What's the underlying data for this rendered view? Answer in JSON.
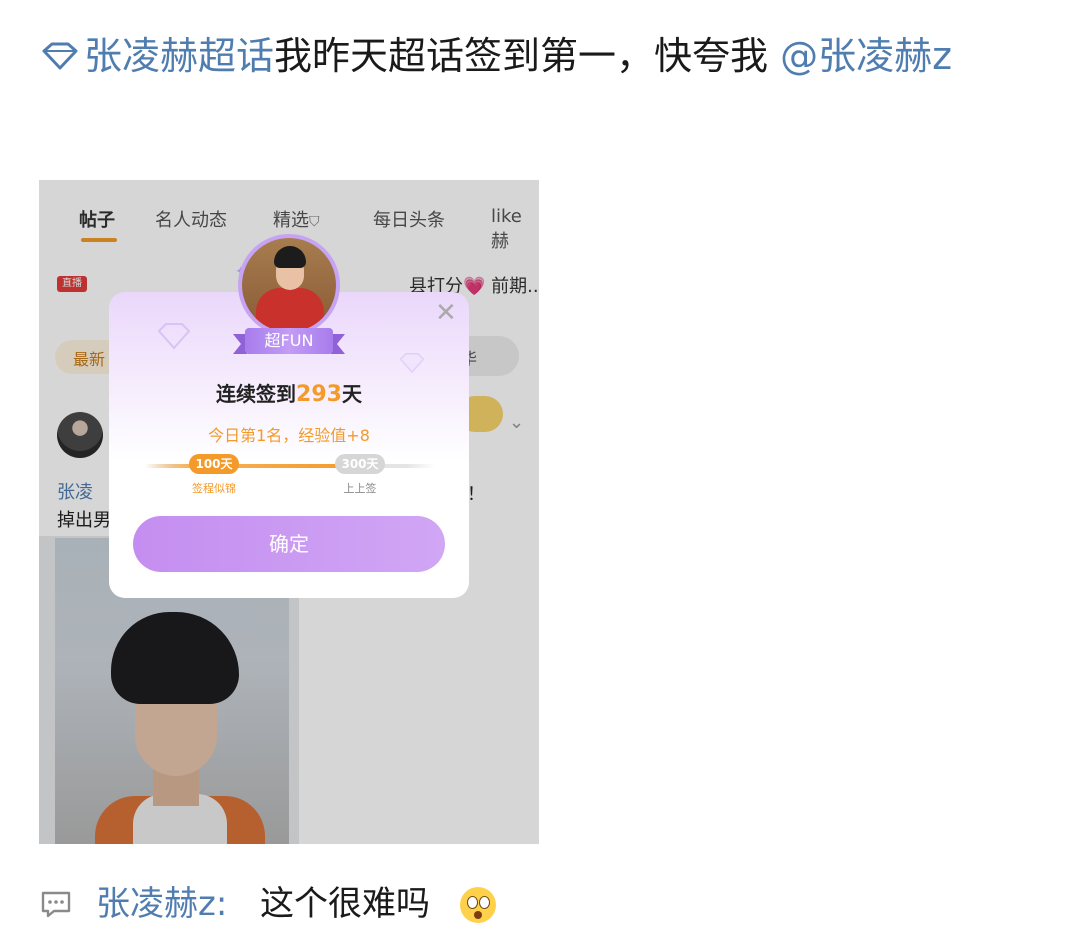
{
  "post": {
    "topic_link": "张凌赫超话",
    "body_text": "我昨天超话签到第一，快夸我",
    "mention": "@张凌赫z"
  },
  "screenshot": {
    "tabs": [
      {
        "label": "帖子",
        "active": true
      },
      {
        "label": "名人动态",
        "active": false
      },
      {
        "label": "精选",
        "active": false
      },
      {
        "label": "每日头条",
        "active": false
      },
      {
        "label": "like赫",
        "active": false
      }
    ],
    "ticker": {
      "badge": "直播",
      "text": "县打分💗 前期..."
    },
    "filter_active": "最新",
    "filter_right": "华",
    "row_name": "张凌",
    "row_text": "掉出男",
    "row_tail": "！！",
    "modal": {
      "ribbon": "超FUN",
      "streak_prefix": "连续签到",
      "streak_days": "293",
      "streak_suffix": "天",
      "rank_text": "今日第1名，经验值+8",
      "milestones": [
        {
          "label": "100天",
          "caption": "签程似锦",
          "reached": true
        },
        {
          "label": "300天",
          "caption": "上上签",
          "reached": false
        }
      ],
      "progress_fraction": 0.73,
      "confirm_label": "确定"
    }
  },
  "comment": {
    "user": "张凌赫z:",
    "text": "这个很难吗"
  },
  "colors": {
    "link": "#507daf",
    "accent_orange": "#f39a2a",
    "modal_purple": "#c48ef0"
  }
}
